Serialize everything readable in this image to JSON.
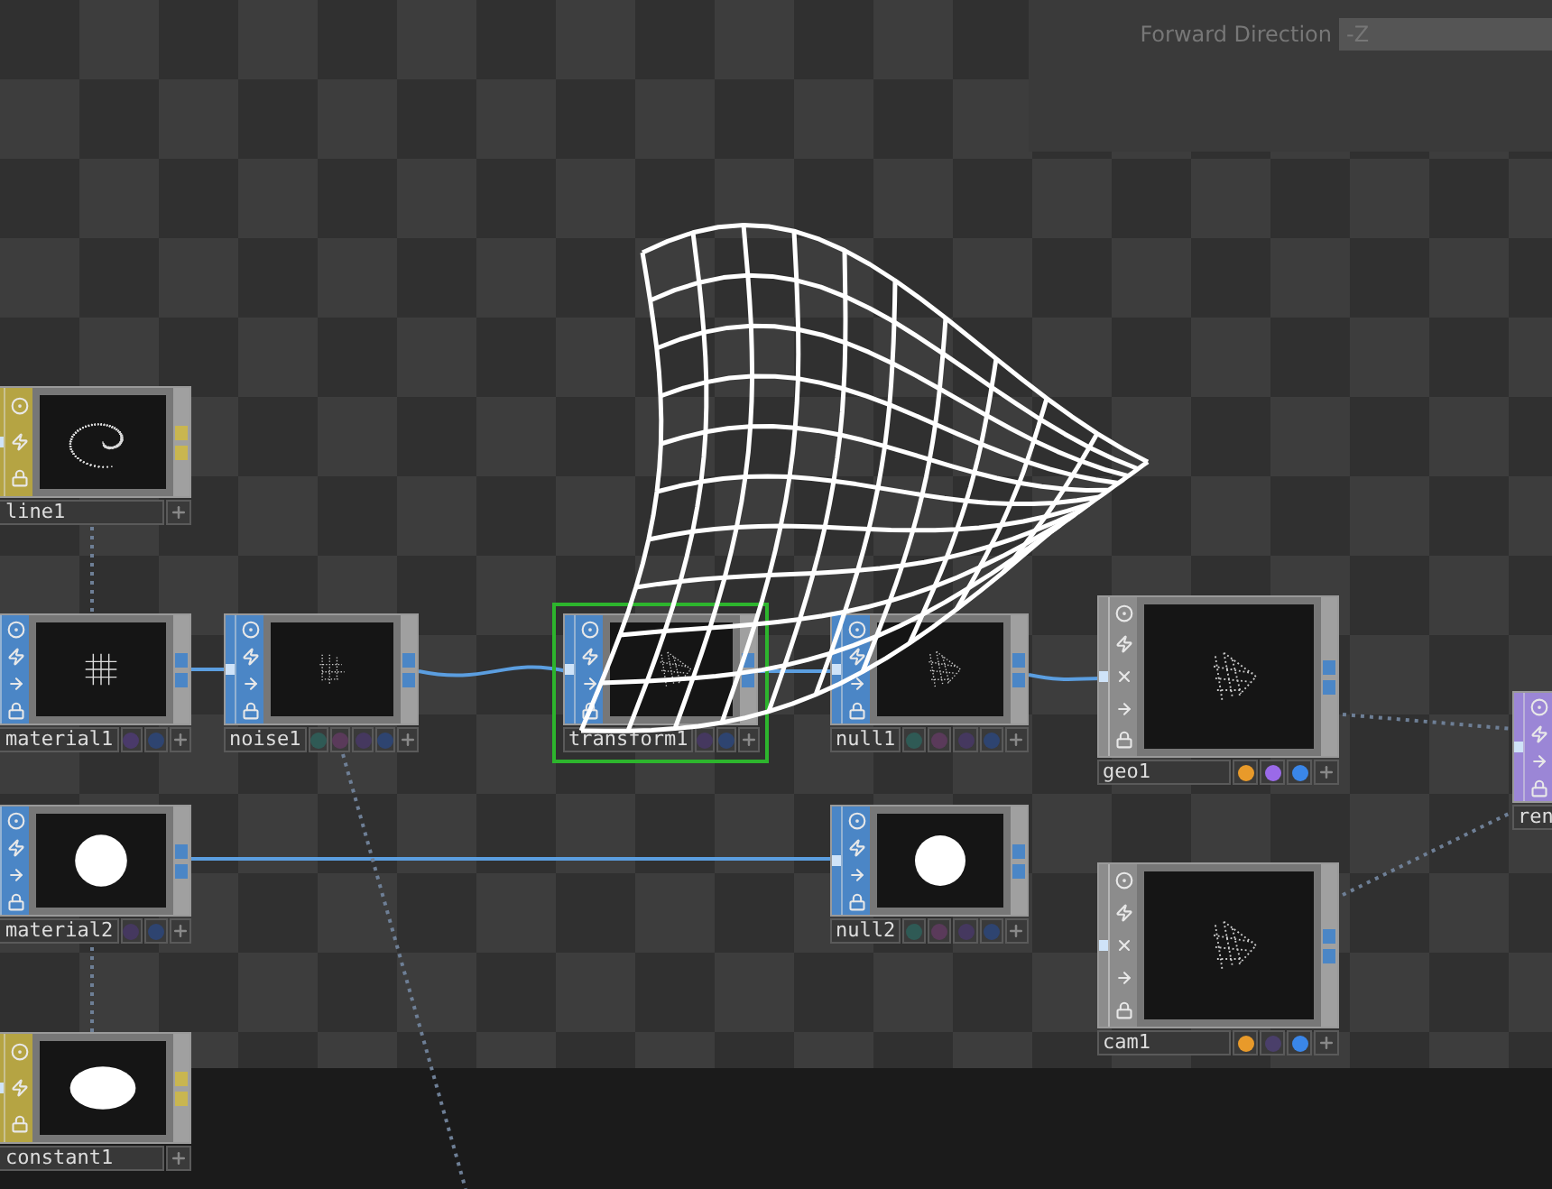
{
  "parameter_panel": {
    "label": "Forward Direction",
    "value": "-Z"
  },
  "nodes": [
    {
      "name": "line1",
      "kind": "mat",
      "preview": {
        "kind": "torus"
      },
      "selected": false
    },
    {
      "name": "material1",
      "kind": "sop",
      "preview": {
        "kind": "grid"
      },
      "selected": false,
      "flags": [
        {
          "color": "#4a3a6a"
        },
        {
          "color": "#2e4470"
        }
      ]
    },
    {
      "name": "noise1",
      "kind": "sop",
      "preview": {
        "kind": "noise"
      },
      "selected": false,
      "flags": [
        {
          "color": "#2f5a55"
        },
        {
          "color": "#5a3a5a"
        },
        {
          "color": "#45385f"
        },
        {
          "color": "#2e4470"
        }
      ]
    },
    {
      "name": "transform1",
      "kind": "sop",
      "preview": {
        "kind": "mesh"
      },
      "selected": true,
      "flags": [
        {
          "color": "#45385f"
        },
        {
          "color": "#2e4470"
        }
      ]
    },
    {
      "name": "null1",
      "kind": "sop",
      "preview": {
        "kind": "mesh"
      },
      "selected": false,
      "flags": [
        {
          "color": "#2f5a55"
        },
        {
          "color": "#5a3a5a"
        },
        {
          "color": "#45385f"
        },
        {
          "color": "#2e4470"
        }
      ]
    },
    {
      "name": "geo1",
      "kind": "comp",
      "preview": {
        "kind": "mesh"
      },
      "selected": false,
      "flags": [
        {
          "color": "#e89a2a"
        },
        {
          "color": "#9a6ae8"
        },
        {
          "color": "#3a86e8"
        }
      ]
    },
    {
      "name": "ren",
      "kind": "top",
      "selected": false
    },
    {
      "name": "material2",
      "kind": "sop",
      "preview": {
        "kind": "circle"
      },
      "selected": false,
      "flags": [
        {
          "color": "#45385f"
        },
        {
          "color": "#2e4470"
        }
      ]
    },
    {
      "name": "null2",
      "kind": "sop",
      "preview": {
        "kind": "circle"
      },
      "selected": false,
      "flags": [
        {
          "color": "#2f5a55"
        },
        {
          "color": "#5a3a5a"
        },
        {
          "color": "#45385f"
        },
        {
          "color": "#2e4470"
        }
      ]
    },
    {
      "name": "cam1",
      "kind": "comp",
      "preview": {
        "kind": "mesh"
      },
      "selected": false,
      "flags": [
        {
          "color": "#e89a2a"
        },
        {
          "color": "#4a3f6a"
        },
        {
          "color": "#3a86e8"
        }
      ]
    },
    {
      "name": "constant1",
      "kind": "mat",
      "preview": {
        "kind": "ellipse"
      },
      "selected": false
    }
  ]
}
